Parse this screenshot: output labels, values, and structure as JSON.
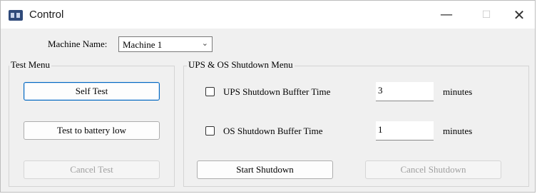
{
  "window": {
    "title": "Control",
    "minimize_glyph": "—",
    "maximize_glyph": "☐",
    "close_glyph": "✕"
  },
  "machine": {
    "label": "Machine Name:",
    "selected": "Machine 1"
  },
  "test_menu": {
    "title": "Test Menu",
    "self_test": "Self Test",
    "test_battery_low": "Test to battery low",
    "cancel_test": "Cancel Test"
  },
  "shutdown_menu": {
    "title": "UPS & OS Shutdown Menu",
    "ups_label": "UPS Shutdown Buffter Time",
    "ups_checked": false,
    "ups_value": "3",
    "ups_unit": "minutes",
    "os_label": "OS Shutdown Buffer Time",
    "os_checked": false,
    "os_value": "1",
    "os_unit": "minutes",
    "start_shutdown": "Start Shutdown",
    "cancel_shutdown": "Cancel Shutdown"
  },
  "icons": {
    "app": "app-icon",
    "dropdown": "chevron-down-icon"
  }
}
